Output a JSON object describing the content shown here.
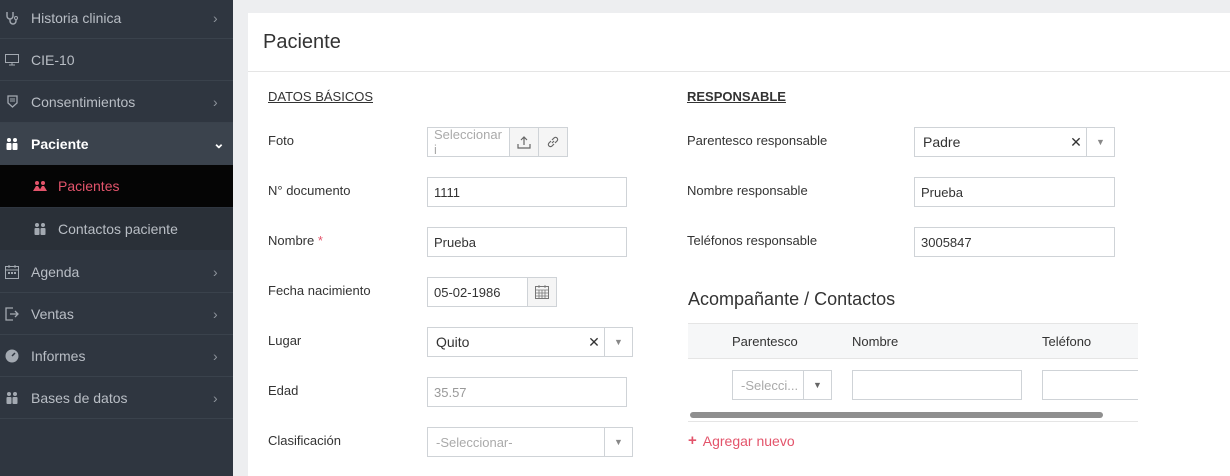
{
  "sidebar": {
    "items": [
      {
        "label": "Historia clinica",
        "icon": "stethoscope-icon"
      },
      {
        "label": "CIE-10",
        "icon": "monitor-icon"
      },
      {
        "label": "Consentimientos",
        "icon": "document-shield-icon"
      },
      {
        "label": "Paciente",
        "icon": "users-icon"
      },
      {
        "label": "Agenda",
        "icon": "calendar-icon"
      },
      {
        "label": "Ventas",
        "icon": "exit-icon"
      },
      {
        "label": "Informes",
        "icon": "dashboard-icon"
      },
      {
        "label": "Bases de datos",
        "icon": "users-icon"
      }
    ],
    "sub_items": [
      {
        "label": "Pacientes",
        "icon": "users-icon"
      },
      {
        "label": "Contactos paciente",
        "icon": "users-icon"
      }
    ]
  },
  "panel": {
    "title": "Paciente",
    "basic_section": "DATOS BÁSICOS",
    "responsible_section": "RESPONSABLE",
    "fields": {
      "foto_label": "Foto",
      "foto_placeholder": "Seleccionar i",
      "documento_label": "N° documento",
      "documento_value": "1111",
      "nombre_label": "Nombre",
      "nombre_required": "*",
      "nombre_value": "Prueba",
      "fecha_label": "Fecha nacimiento",
      "fecha_value": "05-02-1986",
      "lugar_label": "Lugar",
      "lugar_value": "Quito",
      "edad_label": "Edad",
      "edad_value": "35.57",
      "clasificacion_label": "Clasificación",
      "clasificacion_value": "-Seleccionar-"
    },
    "responsible": {
      "parentesco_label": "Parentesco responsable",
      "parentesco_value": "Padre",
      "nombre_label": "Nombre responsable",
      "nombre_value": "Prueba",
      "telefonos_label": "Teléfonos responsable",
      "telefonos_value": "3005847"
    },
    "contacts": {
      "title": "Acompañante / Contactos",
      "columns": [
        "Parentesco",
        "Nombre",
        "Teléfono"
      ],
      "row_parentesco_placeholder": "-Selecci...",
      "add_label": "Agregar nuevo"
    }
  },
  "colors": {
    "sidebar_bg": "#2f3640",
    "accent": "#e3546b",
    "selected_bg": "#050505"
  }
}
